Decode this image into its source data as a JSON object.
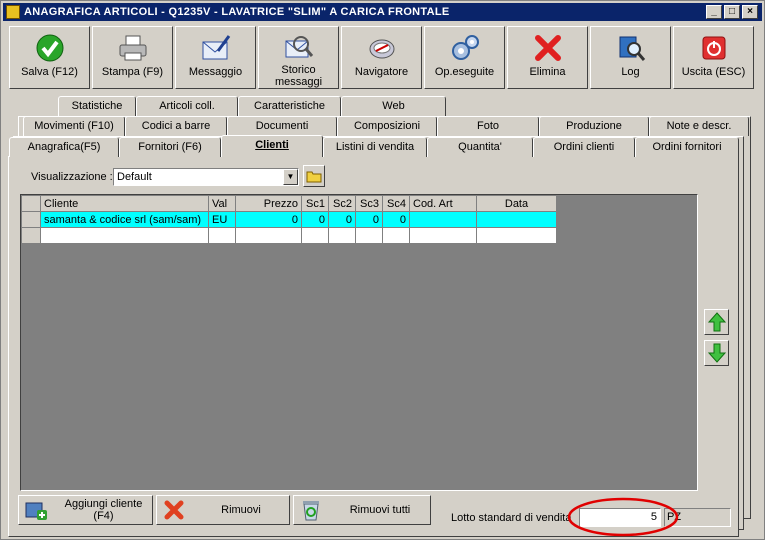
{
  "window": {
    "title": "ANAGRAFICA ARTICOLI - Q1235V - LAVATRICE \"SLIM\"  A CARICA FRONTALE",
    "min": "_",
    "max": "□",
    "close": "×"
  },
  "toolbar": [
    {
      "label": "Salva (F12)",
      "icon": "save-check-icon"
    },
    {
      "label": "Stampa (F9)",
      "icon": "printer-icon"
    },
    {
      "label": "Messaggio",
      "icon": "message-icon"
    },
    {
      "label": "Storico\nmessaggi",
      "icon": "message-history-icon"
    },
    {
      "label": "Navigatore",
      "icon": "compass-icon"
    },
    {
      "label": "Op.eseguite",
      "icon": "gears-icon"
    },
    {
      "label": "Elimina",
      "icon": "delete-x-icon"
    },
    {
      "label": "Log",
      "icon": "log-search-icon"
    },
    {
      "label": "Uscita (ESC)",
      "icon": "power-icon"
    }
  ],
  "tabs": {
    "row1": [
      "Statistiche",
      "Articoli coll.",
      "Caratteristiche",
      "Web"
    ],
    "row2": [
      "Movimenti (F10)",
      "Codici a barre",
      "Documenti",
      "Composizioni",
      "Foto",
      "Produzione",
      "Note e descr."
    ],
    "row3": [
      "Anagrafica(F5)",
      "Fornitori (F6)",
      "Clienti",
      "Listini di vendita",
      "Quantita'",
      "Ordini clienti",
      "Ordini fornitori"
    ],
    "active": "Clienti"
  },
  "view": {
    "label": "Visualizzazione :",
    "value": "Default"
  },
  "grid": {
    "columns": [
      "Cliente",
      "Val",
      "Prezzo",
      "Sc1",
      "Sc2",
      "Sc3",
      "Sc4",
      "Cod. Art",
      "Data"
    ],
    "rows": [
      [
        "samanta & codice srl (sam/sam)",
        "EU",
        "0",
        "0",
        "0",
        "0",
        "0",
        "",
        ""
      ],
      [
        "",
        "",
        "",
        "",
        "",
        "",
        "",
        "",
        ""
      ]
    ]
  },
  "buttons": {
    "add": "Aggiungi cliente (F4)",
    "remove": "Rimuovi",
    "remove_all": "Rimuovi tutti"
  },
  "lotto": {
    "label": "Lotto standard di vendita",
    "value": "5",
    "unit": "PZ"
  },
  "colors": {
    "title_bar": "#0a246a",
    "selected_row": "#00ffff",
    "highlight_circle": "#e00000"
  }
}
